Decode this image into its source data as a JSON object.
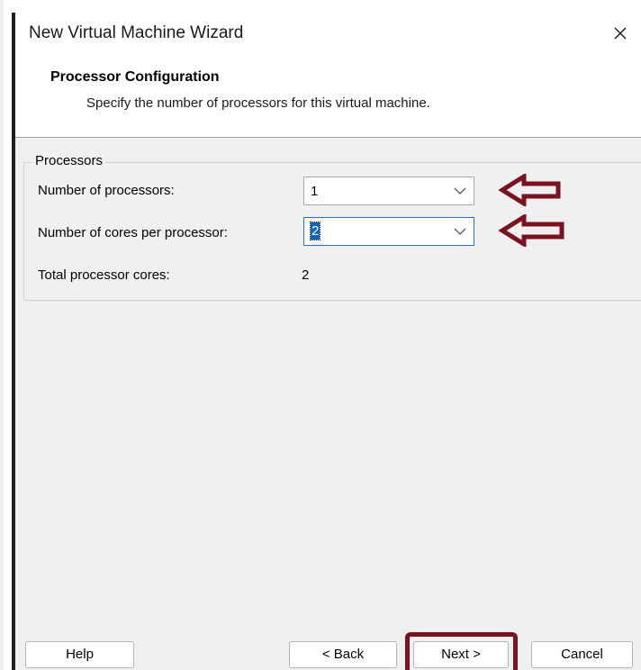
{
  "window": {
    "title": "New Virtual Machine Wizard",
    "close_glyph": "✕"
  },
  "header": {
    "title": "Processor Configuration",
    "subtitle": "Specify the number of processors for this virtual machine."
  },
  "processors_group": {
    "legend": "Processors",
    "num_processors_label": "Number of processors:",
    "num_processors_value": "1",
    "cores_per_processor_label": "Number of cores per processor:",
    "cores_per_processor_value": "2",
    "total_cores_label": "Total processor cores:",
    "total_cores_value": "2"
  },
  "buttons": {
    "help": "Help",
    "back": "< Back",
    "next": "Next >",
    "cancel": "Cancel"
  },
  "colors": {
    "annotation": "#7a1220",
    "focus": "#2a6fd6",
    "selection": "#0a64c8"
  },
  "icons": {
    "close": "close-icon",
    "dropdown": "chevron-down-icon",
    "annotation_arrow": "left-arrow-icon"
  }
}
